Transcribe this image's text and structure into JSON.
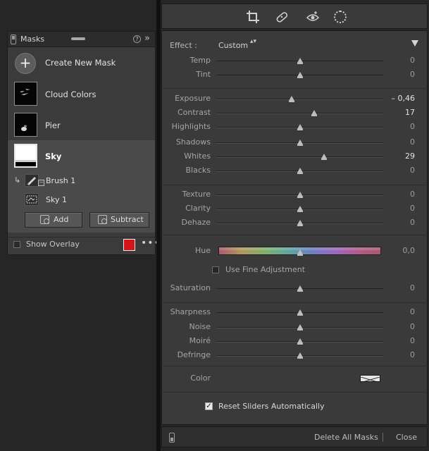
{
  "masks_panel": {
    "title": "Masks",
    "help_glyph": "?",
    "collapse_glyph": "»",
    "create_new_label": "Create New Mask",
    "create_new_glyph": "+",
    "masks": [
      {
        "label": "Cloud Colors"
      },
      {
        "label": "Pier"
      },
      {
        "label": "Sky",
        "selected": true
      }
    ],
    "sub_components": [
      {
        "label": "Brush 1",
        "icon": "brush-icon"
      },
      {
        "label": "Sky 1",
        "icon": "sky-icon"
      }
    ],
    "add_label": "Add",
    "subtract_label": "Subtract",
    "show_overlay_label": "Show Overlay",
    "overlay_color": "#d4141a",
    "more_glyph": "•••",
    "sub_arrow": "↳",
    "minus_glyph": "−"
  },
  "tools": [
    {
      "name": "crop-icon",
      "glyph": "⌗"
    },
    {
      "name": "heal-icon",
      "glyph": "✚"
    },
    {
      "name": "redeye-icon",
      "glyph": "◉"
    },
    {
      "name": "masking-icon",
      "glyph": "◌",
      "active": true
    }
  ],
  "effect": {
    "label": "Effect :",
    "value": "Custom",
    "arrows": "▴▾"
  },
  "sliders": {
    "temp": {
      "label": "Temp",
      "value": "0",
      "position": 0.5
    },
    "tint": {
      "label": "Tint",
      "value": "0",
      "position": 0.5
    },
    "exposure": {
      "label": "Exposure",
      "value": "– 0,46",
      "position": 0.45
    },
    "contrast": {
      "label": "Contrast",
      "value": "17",
      "position": 0.585
    },
    "highlights": {
      "label": "Highlights",
      "value": "0",
      "position": 0.5
    },
    "shadows": {
      "label": "Shadows",
      "value": "0",
      "position": 0.5
    },
    "whites": {
      "label": "Whites",
      "value": "29",
      "position": 0.645
    },
    "blacks": {
      "label": "Blacks",
      "value": "0",
      "position": 0.5
    },
    "texture": {
      "label": "Texture",
      "value": "0",
      "position": 0.5
    },
    "clarity": {
      "label": "Clarity",
      "value": "0",
      "position": 0.5
    },
    "dehaze": {
      "label": "Dehaze",
      "value": "0",
      "position": 0.5
    },
    "hue": {
      "label": "Hue",
      "value": "0,0",
      "position": 0.5
    },
    "saturation": {
      "label": "Saturation",
      "value": "0",
      "position": 0.5
    },
    "sharpness": {
      "label": "Sharpness",
      "value": "0",
      "position": 0.5
    },
    "noise": {
      "label": "Noise",
      "value": "0",
      "position": 0.5
    },
    "moire": {
      "label": "Moiré",
      "value": "0",
      "position": 0.5
    },
    "defringe": {
      "label": "Defringe",
      "value": "0",
      "position": 0.5
    }
  },
  "fine_adjustment_label": "Use Fine Adjustment",
  "color_label": "Color",
  "reset_sliders_label": "Reset Sliders Automatically",
  "reset_checked_glyph": "✓",
  "effect_menu_glyph": "▼",
  "footer": {
    "delete_all_label": "Delete All Masks",
    "close_label": "Close"
  }
}
